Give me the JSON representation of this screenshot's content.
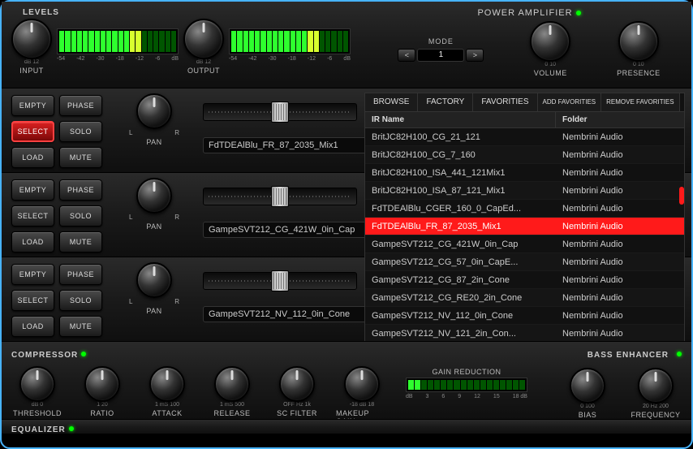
{
  "levels": {
    "title": "LEVELS",
    "input_label": "INPUT",
    "output_label": "OUTPUT",
    "scale_min": "dB",
    "scale_labels": [
      "-54",
      "-42",
      "-30",
      "-18",
      "-12",
      "-6",
      "dB"
    ],
    "tick_input": "dB          12",
    "tick_output": "dB          12"
  },
  "power_amp": {
    "title": "POWER AMPLIFIER",
    "mode_label": "MODE",
    "mode_value": "1",
    "prev_icon": "<",
    "next_icon": ">",
    "volume_label": "VOLUME",
    "volume_ticks": "0          10",
    "presence_label": "PRESENCE",
    "presence_ticks": "0          10"
  },
  "slots": [
    {
      "buttons": {
        "empty": "EMPTY",
        "phase": "PHASE",
        "select": "SELECT",
        "solo": "SOLO",
        "load": "LOAD",
        "mute": "MUTE"
      },
      "select_active": true,
      "pan_label": "PAN",
      "pan_l": "L",
      "pan_r": "R",
      "name": "FdTDEAlBlu_FR_87_2035_Mix1"
    },
    {
      "buttons": {
        "empty": "EMPTY",
        "phase": "PHASE",
        "select": "SELECT",
        "solo": "SOLO",
        "load": "LOAD",
        "mute": "MUTE"
      },
      "select_active": false,
      "pan_label": "PAN",
      "pan_l": "L",
      "pan_r": "R",
      "name": "GampeSVT212_CG_421W_0in_Cap"
    },
    {
      "buttons": {
        "empty": "EMPTY",
        "phase": "PHASE",
        "select": "SELECT",
        "solo": "SOLO",
        "load": "LOAD",
        "mute": "MUTE"
      },
      "select_active": false,
      "pan_label": "PAN",
      "pan_l": "L",
      "pan_r": "R",
      "name": "GampeSVT212_NV_112_0in_Cone"
    }
  ],
  "browser": {
    "tabs": {
      "browse": "BROWSE",
      "factory": "FACTORY",
      "favorites": "FAVORITIES",
      "add_fav": "ADD FAVORITIES",
      "remove_fav": "REMOVE FAVORITIES"
    },
    "col_ir": "IR Name",
    "col_folder": "Folder",
    "rows": [
      {
        "name": "BritJC82H100_CG_21_121",
        "folder": "Nembrini Audio",
        "sel": false
      },
      {
        "name": "BritJC82H100_CG_7_160",
        "folder": "Nembrini Audio",
        "sel": false
      },
      {
        "name": "BritJC82H100_ISA_441_121Mix1",
        "folder": "Nembrini Audio",
        "sel": false
      },
      {
        "name": "BritJC82H100_ISA_87_121_Mix1",
        "folder": "Nembrini Audio",
        "sel": false
      },
      {
        "name": "FdTDEAlBlu_CGER_160_0_CapEd...",
        "folder": "Nembrini Audio",
        "sel": false
      },
      {
        "name": "FdTDEAlBlu_FR_87_2035_Mix1",
        "folder": "Nembrini Audio",
        "sel": true
      },
      {
        "name": "GampeSVT212_CG_421W_0in_Cap",
        "folder": "Nembrini Audio",
        "sel": false
      },
      {
        "name": "GampeSVT212_CG_57_0in_CapE...",
        "folder": "Nembrini Audio",
        "sel": false
      },
      {
        "name": "GampeSVT212_CG_87_2in_Cone",
        "folder": "Nembrini Audio",
        "sel": false
      },
      {
        "name": "GampeSVT212_CG_RE20_2in_Cone",
        "folder": "Nembrini Audio",
        "sel": false
      },
      {
        "name": "GampeSVT212_NV_112_0in_Cone",
        "folder": "Nembrini Audio",
        "sel": false
      },
      {
        "name": "GampeSVT212_NV_121_2in_Con...",
        "folder": "Nembrini Audio",
        "sel": false
      }
    ]
  },
  "compressor": {
    "title": "COMPRESSOR",
    "threshold_label": "THRESHOLD",
    "threshold_ticks": "dB         0",
    "ratio_label": "RATIO",
    "ratio_ticks": "1          20",
    "attack_label": "ATTACK",
    "attack_ticks": "1  mS  100",
    "release_label": "RELEASE",
    "release_ticks": "1  mS  500",
    "scfilter_label": "SC FILTER",
    "scfilter_ticks": "OFF   Hz  1k",
    "makeup_label": "MAKEUP GAIN",
    "makeup_ticks": "-18  dB  18",
    "gr_label": "GAIN REDUCTION",
    "gr_scale": [
      "dB",
      "3",
      "6",
      "9",
      "12",
      "15",
      "18 dB"
    ]
  },
  "bass": {
    "title": "BASS ENHANCER",
    "bias_label": "BIAS",
    "bias_ticks": "0       100",
    "freq_label": "FREQUENCY",
    "freq_ticks": "20  Hz  200"
  },
  "eq": {
    "title": "EQUALIZER"
  }
}
